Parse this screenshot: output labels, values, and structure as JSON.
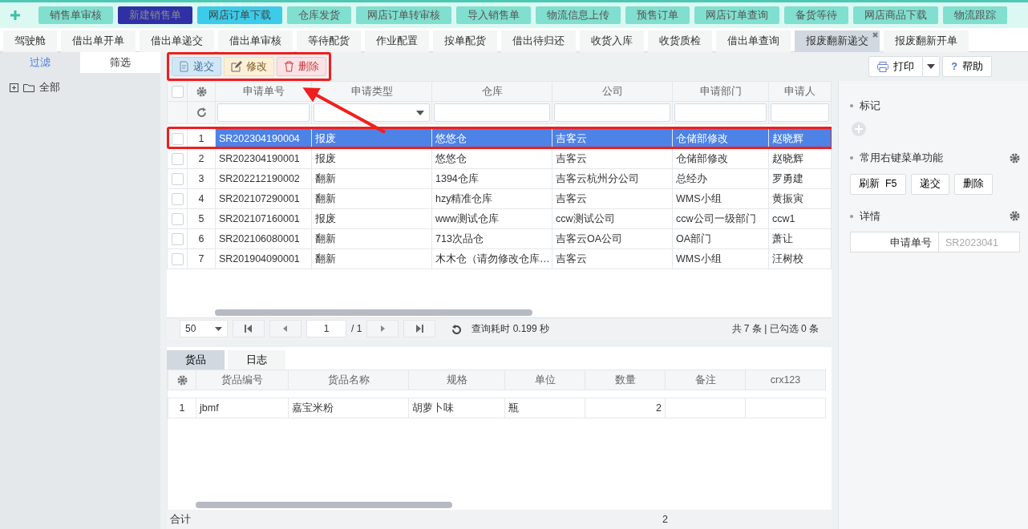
{
  "top_menu": [
    {
      "label": "销售单审核",
      "kind": "normal"
    },
    {
      "label": "新建销售单",
      "kind": "dark"
    },
    {
      "label": "网店订单下载",
      "kind": "bright"
    },
    {
      "label": "仓库发货",
      "kind": "normal"
    },
    {
      "label": "网店订单转审核",
      "kind": "normal"
    },
    {
      "label": "导入销售单",
      "kind": "normal"
    },
    {
      "label": "物流信息上传",
      "kind": "normal"
    },
    {
      "label": "预售订单",
      "kind": "normal"
    },
    {
      "label": "网店订单查询",
      "kind": "normal"
    },
    {
      "label": "备货等待",
      "kind": "normal"
    },
    {
      "label": "网店商品下载",
      "kind": "normal"
    },
    {
      "label": "物流跟踪",
      "kind": "normal"
    }
  ],
  "tabs": [
    {
      "label": "驾驶舱",
      "selected": false
    },
    {
      "label": "借出单开单",
      "selected": false
    },
    {
      "label": "借出单递交",
      "selected": false
    },
    {
      "label": "借出单审核",
      "selected": false
    },
    {
      "label": "等待配货",
      "selected": false
    },
    {
      "label": "作业配置",
      "selected": false
    },
    {
      "label": "按单配货",
      "selected": false
    },
    {
      "label": "借出待归还",
      "selected": false
    },
    {
      "label": "收货入库",
      "selected": false
    },
    {
      "label": "收货质检",
      "selected": false
    },
    {
      "label": "借出单查询",
      "selected": false
    },
    {
      "label": "报废翻新递交",
      "selected": true
    },
    {
      "label": "报废翻新开单",
      "selected": false
    }
  ],
  "left_panel": {
    "tabs": [
      {
        "label": "过滤",
        "selected": true
      },
      {
        "label": "筛选",
        "selected": false
      }
    ],
    "tree": [
      {
        "label": "全部",
        "expanded": false
      }
    ]
  },
  "toolbar": {
    "annotated": true,
    "buttons": [
      {
        "label": "递交",
        "kind": "submit"
      },
      {
        "label": "修改",
        "kind": "edit"
      },
      {
        "label": "删除",
        "kind": "delete"
      }
    ],
    "right_buttons": [
      {
        "label": "打印",
        "kind": "print"
      },
      {
        "label": "帮助",
        "kind": "help",
        "glyph": "?"
      }
    ]
  },
  "grid": {
    "arrow": true,
    "all_checked": false,
    "columns": [
      "申请单号",
      "申请类型",
      "仓库",
      "公司",
      "申请部门",
      "申请人"
    ],
    "rows": [
      {
        "no": "1",
        "selected": true,
        "checked": false,
        "annotated": true,
        "cells": [
          "SR202304190004",
          "报废",
          "悠悠仓",
          "吉客云",
          "仓储部修改",
          "赵晓辉"
        ]
      },
      {
        "no": "2",
        "selected": false,
        "checked": false,
        "annotated": false,
        "cells": [
          "SR202304190001",
          "报废",
          "悠悠仓",
          "吉客云",
          "仓储部修改",
          "赵晓辉"
        ]
      },
      {
        "no": "3",
        "selected": false,
        "checked": false,
        "annotated": false,
        "cells": [
          "SR202212190002",
          "翻新",
          "1394仓库",
          "吉客云杭州分公司",
          "总经办",
          "罗勇建"
        ]
      },
      {
        "no": "4",
        "selected": false,
        "checked": false,
        "annotated": false,
        "cells": [
          "SR202107290001",
          "翻新",
          "hzy精准仓库",
          "吉客云",
          "WMS小组",
          "黄振寅"
        ]
      },
      {
        "no": "5",
        "selected": false,
        "checked": false,
        "annotated": false,
        "cells": [
          "SR202107160001",
          "报废",
          "www测试仓库",
          "ccw测试公司",
          "ccw公司一级部门",
          "ccw1"
        ]
      },
      {
        "no": "6",
        "selected": false,
        "checked": false,
        "annotated": false,
        "cells": [
          "SR202106080001",
          "翻新",
          "713次品仓",
          "吉客云OA公司",
          "OA部门",
          "萧让"
        ]
      },
      {
        "no": "7",
        "selected": false,
        "checked": false,
        "annotated": false,
        "cells": [
          "SR201904090001",
          "翻新",
          "木木仓（请勿修改仓库…",
          "吉客云",
          "WMS小组",
          "汪树校"
        ]
      }
    ]
  },
  "pager": {
    "page_size": "50",
    "page": "1",
    "total_pages": "/ 1",
    "query_time": "查询耗时 0.199 秒",
    "summary": "共 7 条 | 已勾选 0 条"
  },
  "detail": {
    "tabs": [
      {
        "label": "货品",
        "selected": true
      },
      {
        "label": "日志",
        "selected": false
      }
    ],
    "columns": [
      "货品编号",
      "货品名称",
      "规格",
      "单位",
      "数量",
      "备注",
      "crx123"
    ],
    "rows": [
      {
        "no": "1",
        "cells": [
          "jbmf",
          "嘉宝米粉",
          "胡萝卜味",
          "瓶",
          "2"
        ]
      }
    ],
    "footer": {
      "label": "合计",
      "total": "2"
    }
  },
  "side": {
    "sections": [
      {
        "title": "标记",
        "kind": "tags",
        "settings": false
      },
      {
        "title": "常用右键菜单功能",
        "kind": "actions",
        "settings": true,
        "buttons": [
          "刷新  F5",
          "递交",
          "删除"
        ]
      },
      {
        "title": "详情",
        "kind": "details",
        "settings": true,
        "fields": [
          {
            "label": "申请单号",
            "value": "SR2023041"
          }
        ]
      }
    ]
  }
}
